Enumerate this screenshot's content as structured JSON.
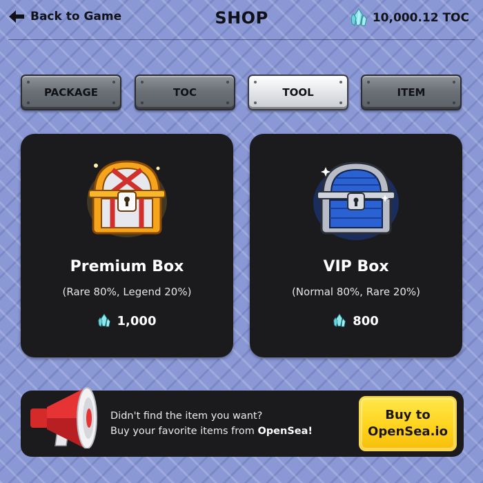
{
  "header": {
    "back_label": "Back to Game",
    "title": "SHOP",
    "balance": "10,000.12 TOC"
  },
  "tabs": [
    {
      "label": "PACKAGE",
      "active": false
    },
    {
      "label": "TOC",
      "active": false
    },
    {
      "label": "TOOL",
      "active": true
    },
    {
      "label": "ITEM",
      "active": false
    }
  ],
  "products": [
    {
      "name": "Premium Box",
      "odds": "(Rare 80%, Legend 20%)",
      "price": "1,000",
      "icon": "gold-treasure-chest-icon"
    },
    {
      "name": "VIP Box",
      "odds": "(Normal 80%, Rare 20%)",
      "price": "800",
      "icon": "blue-treasure-chest-icon"
    }
  ],
  "banner": {
    "line1": "Didn't find the item you want?",
    "line2_prefix": "Buy your favorite items from ",
    "line2_emphasis": "OpenSea!",
    "button_line1": "Buy to",
    "button_line2": "OpenSea.io"
  },
  "colors": {
    "background": "#8a98d6",
    "card": "#1b1b1d",
    "buy_button": "#ffd21a",
    "crystal": "#7fe3e8"
  }
}
